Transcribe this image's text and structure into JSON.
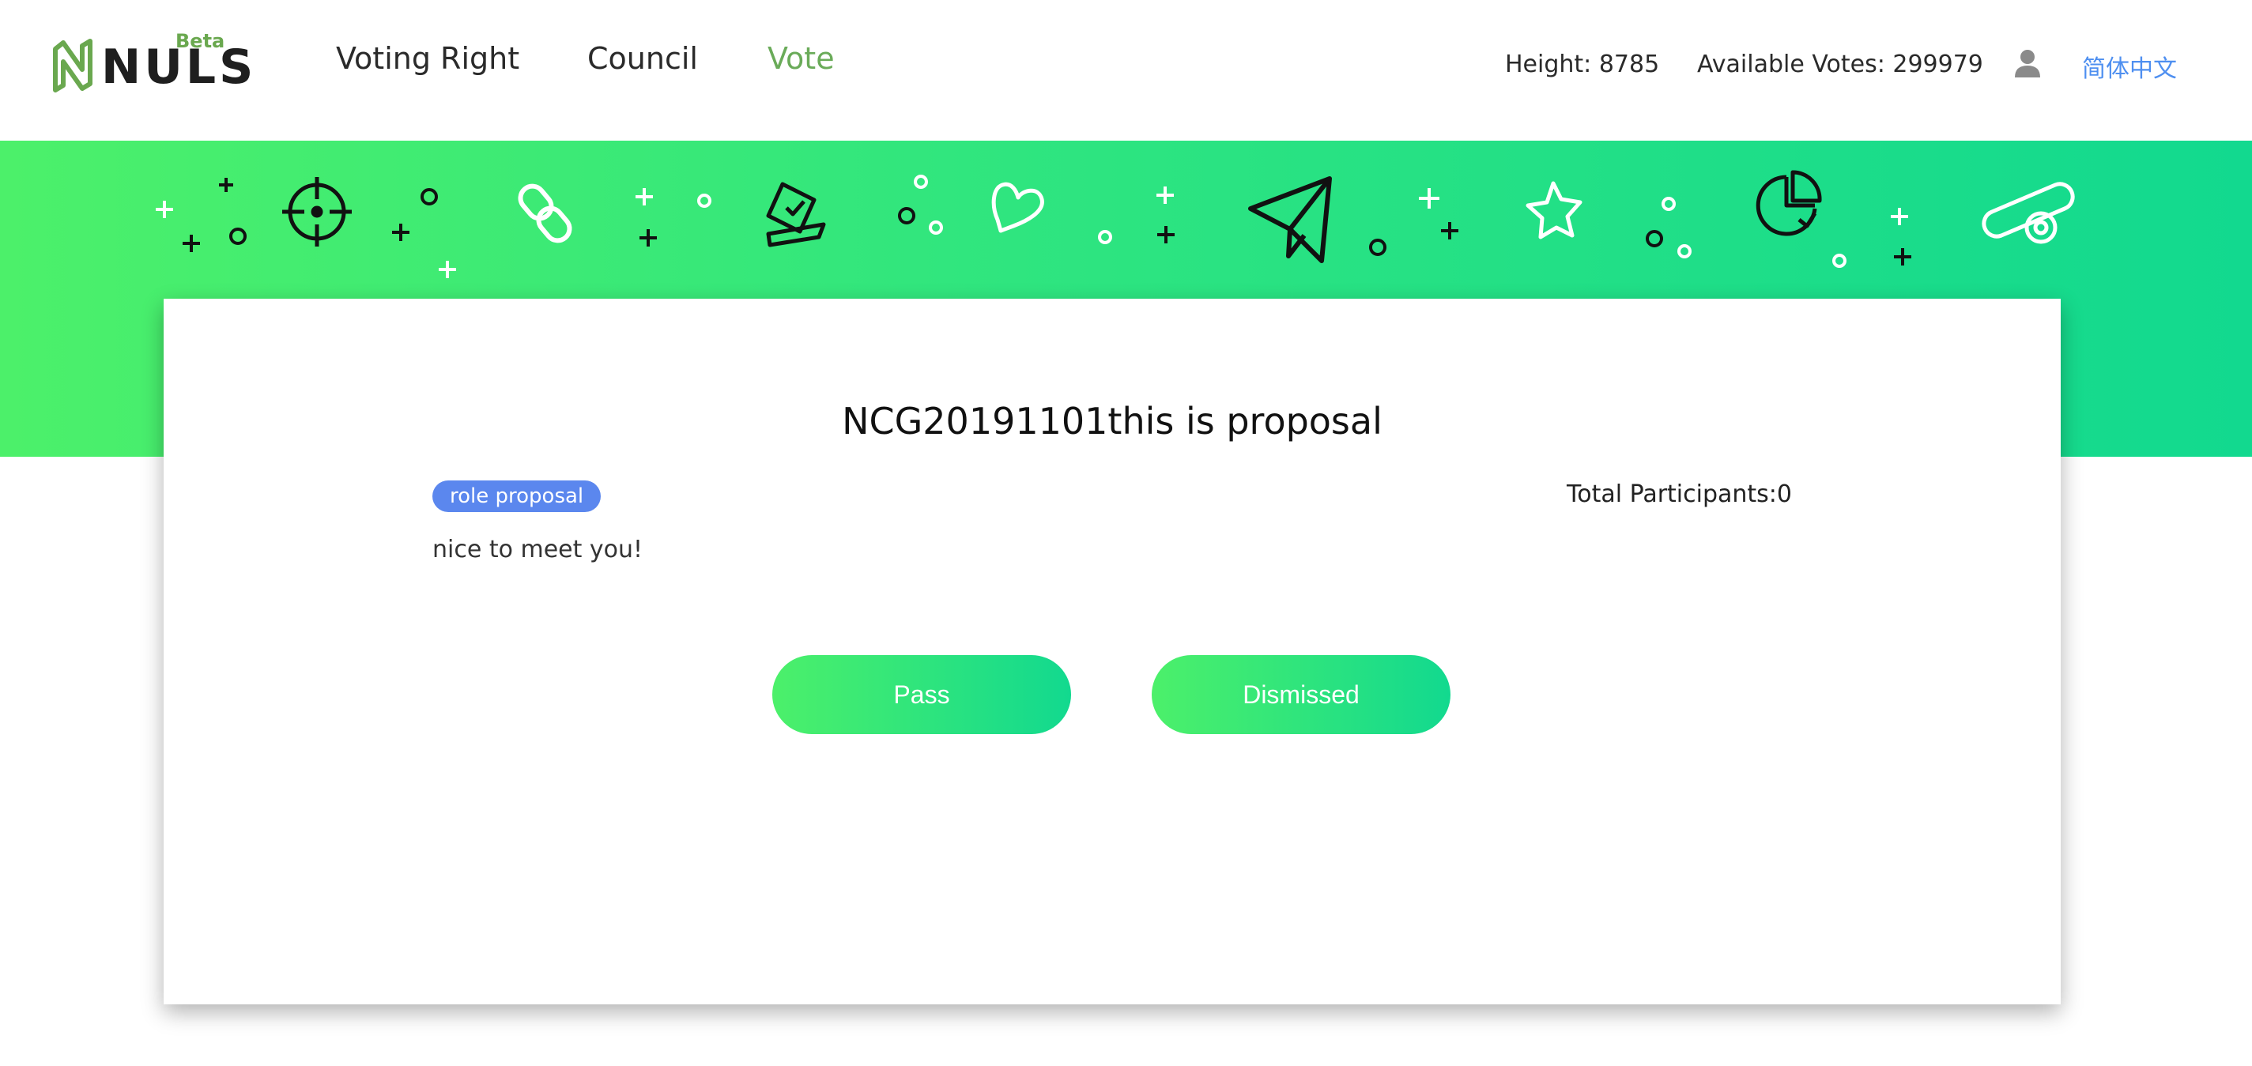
{
  "header": {
    "logo_text": "NULS",
    "logo_badge": "Beta",
    "nav": [
      {
        "label": "Voting Right"
      },
      {
        "label": "Council"
      },
      {
        "label": "Vote"
      }
    ],
    "height": "Height: 8785",
    "available_votes": "Available Votes: 299979",
    "user_icon": "user-icon",
    "language": "简体中文"
  },
  "colors": {
    "brand_green": "#6aab59",
    "banner_gradient_start": "#4cf06a",
    "banner_gradient_end": "#12d98f",
    "tag_blue": "#5b87ee",
    "link_blue": "#4e8ff0"
  },
  "banner": {
    "icons": [
      "crosshair-icon",
      "link-icon",
      "ballot-box-icon",
      "heart-icon",
      "paper-plane-icon",
      "star-icon",
      "pie-chart-icon",
      "coin-roll-icon"
    ]
  },
  "proposal": {
    "title": "NCG20191101this is proposal",
    "tag": "role proposal",
    "participants": "Total Participants:0",
    "description": "nice to meet you!",
    "pass_label": "Pass",
    "dismissed_label": "Dismissed"
  }
}
